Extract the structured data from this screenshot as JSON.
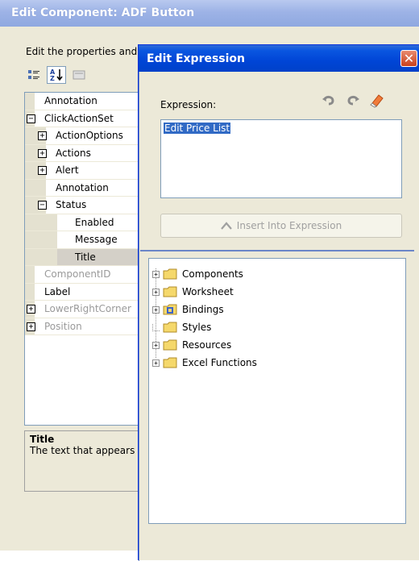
{
  "back_window": {
    "title": "Edit Component: ADF Button",
    "intro_text": "Edit the properties and",
    "properties": [
      {
        "label": "Annotation",
        "level": 0,
        "expander": "",
        "disabled": false,
        "selected": false
      },
      {
        "label": "ClickActionSet",
        "level": 0,
        "expander": "minus",
        "disabled": false,
        "selected": false
      },
      {
        "label": "ActionOptions",
        "level": 1,
        "expander": "plus",
        "disabled": false,
        "selected": false
      },
      {
        "label": "Actions",
        "level": 1,
        "expander": "plus",
        "disabled": false,
        "selected": false
      },
      {
        "label": "Alert",
        "level": 1,
        "expander": "plus",
        "disabled": false,
        "selected": false
      },
      {
        "label": "Annotation",
        "level": 1,
        "expander": "",
        "disabled": false,
        "selected": false
      },
      {
        "label": "Status",
        "level": 1,
        "expander": "minus",
        "disabled": false,
        "selected": false
      },
      {
        "label": "Enabled",
        "level": 2,
        "expander": "",
        "disabled": false,
        "selected": false
      },
      {
        "label": "Message",
        "level": 2,
        "expander": "",
        "disabled": false,
        "selected": false
      },
      {
        "label": "Title",
        "level": 2,
        "expander": "",
        "disabled": false,
        "selected": true
      },
      {
        "label": "ComponentID",
        "level": 0,
        "expander": "",
        "disabled": true,
        "selected": false
      },
      {
        "label": "Label",
        "level": 0,
        "expander": "",
        "disabled": false,
        "selected": false
      },
      {
        "label": "LowerRightCorner",
        "level": 0,
        "expander": "plus",
        "disabled": true,
        "selected": false
      },
      {
        "label": "Position",
        "level": 0,
        "expander": "plus",
        "disabled": true,
        "selected": false
      }
    ],
    "description": {
      "title": "Title",
      "text": "The text that appears"
    },
    "toolbar_icons": [
      "categorized-icon",
      "sort-alpha-icon",
      "property-pages-icon"
    ]
  },
  "dialog": {
    "title": "Edit Expression",
    "close_glyph": "✕",
    "expression_label": "Expression:",
    "expression_value": "Edit Price List",
    "insert_button_label": "Insert Into Expression",
    "tool_icons": [
      "undo-icon",
      "redo-icon",
      "eraser-icon"
    ],
    "tree": [
      {
        "label": "Components",
        "expander": "plus",
        "folder": "plain"
      },
      {
        "label": "Worksheet",
        "expander": "plus",
        "folder": "plain"
      },
      {
        "label": "Bindings",
        "expander": "plus",
        "folder": "bindings"
      },
      {
        "label": "Styles",
        "expander": "",
        "folder": "plain"
      },
      {
        "label": "Resources",
        "expander": "plus",
        "folder": "plain"
      },
      {
        "label": "Excel Functions",
        "expander": "plus",
        "folder": "plain"
      }
    ]
  },
  "colors": {
    "dialog_title_blue": "#0045d6",
    "back_title_blue": "#9db3e6",
    "selection_blue": "#316ac5",
    "folder_yellow": "#f5d86b"
  }
}
